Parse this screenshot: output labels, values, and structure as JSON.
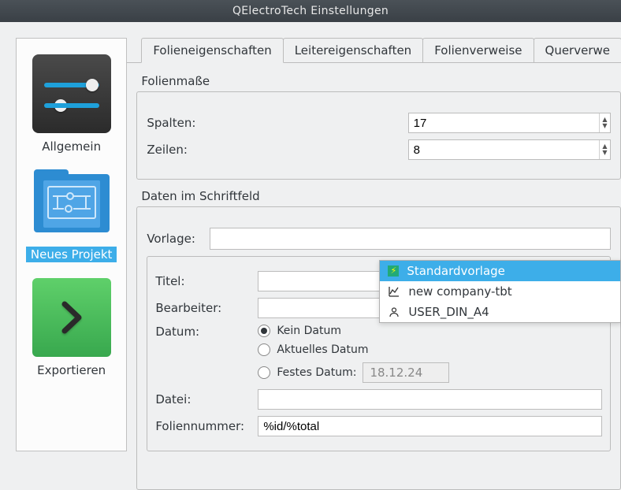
{
  "title": "QElectroTech Einstellungen",
  "sidebar": {
    "items": [
      {
        "label": "Allgemein"
      },
      {
        "label": "Neues Projekt"
      },
      {
        "label": "Exportieren"
      }
    ],
    "selected_index": 1
  },
  "tabs": [
    {
      "label": "Folieneigenschaften"
    },
    {
      "label": "Leitereigenschaften"
    },
    {
      "label": "Folienverweise"
    },
    {
      "label": "Querverwe"
    }
  ],
  "active_tab": 0,
  "dims": {
    "heading": "Folienmaße",
    "cols_label": "Spalten:",
    "cols_value": "17",
    "rows_label": "Zeilen:",
    "rows_value": "8"
  },
  "titleblock": {
    "heading": "Daten im Schriftfeld",
    "template_label": "Vorlage:",
    "options": [
      {
        "label": "Standardvorlage",
        "icon": "lightning"
      },
      {
        "label": "new company-tbt",
        "icon": "chart"
      },
      {
        "label": "USER_DIN_A4",
        "icon": "user"
      }
    ],
    "selected_option": 0,
    "title_label": "Titel:",
    "author_label": "Bearbeiter:",
    "date_label": "Datum:",
    "date_opts": {
      "none": "Kein Datum",
      "current": "Aktuelles Datum",
      "fixed": "Festes Datum:",
      "fixed_value": "18.12.24",
      "selected": "none"
    },
    "file_label": "Datei:",
    "folio_label": "Foliennummer:",
    "folio_value": "%id/%total"
  }
}
